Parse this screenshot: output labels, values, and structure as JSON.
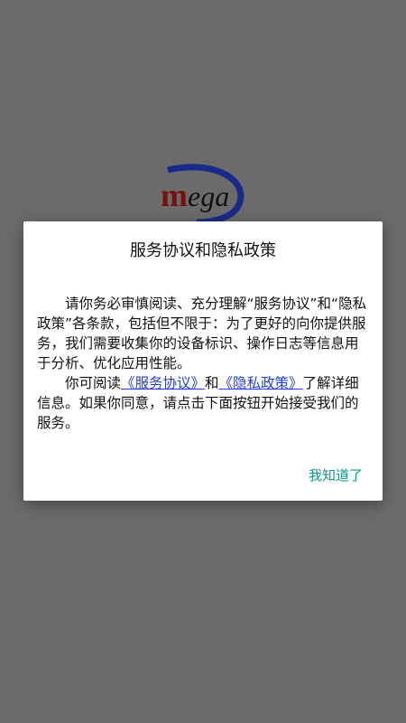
{
  "logo": {
    "text_m": "m",
    "text_rest": "ega",
    "colors": {
      "ring": "#1a2a8a",
      "m": "#7a0f0f"
    }
  },
  "dialog": {
    "title": "服务协议和隐私政策",
    "paragraph1": "请你务必审慎阅读、充分理解“服务协议”和“隐私政策”各条款，包括但不限于：为了更好的向你提供服务，我们需要收集你的设备标识、操作日志等信息用于分析、优化应用性能。",
    "paragraph2_prefix": "你可阅读",
    "service_link": "《服务协议》",
    "and": "和",
    "privacy_link": "《隐私政策》",
    "paragraph2_suffix": "了解详细信息。如果你同意，请点击下面按钮开始接受我们的服务。",
    "ok_button": "我知道了",
    "colors": {
      "link": "#1f3fe0",
      "button": "#0a9a8c",
      "overlay": "#6b6b6b"
    }
  }
}
